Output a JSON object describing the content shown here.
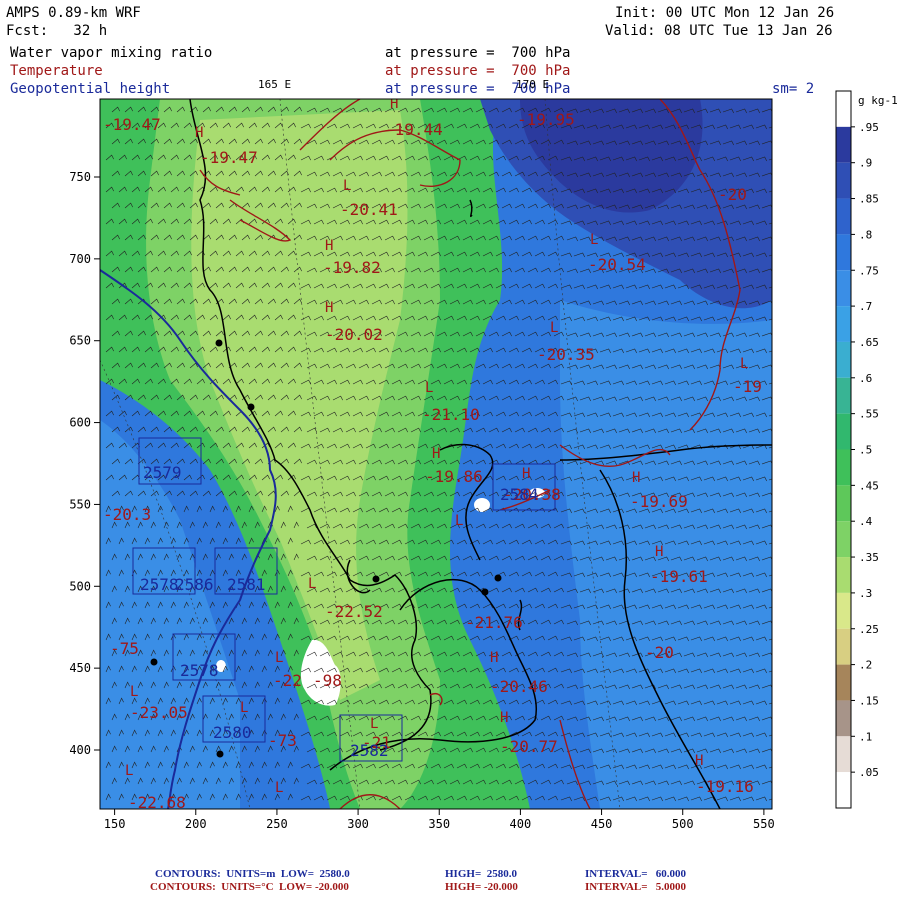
{
  "header": {
    "model": "AMPS 0.89-km WRF",
    "forecast": "Fcst:   32 h",
    "init": "Init: 00 UTC Mon 12 Jan 26",
    "valid": "Valid: 08 UTC Tue 13 Jan 26",
    "field1": "Water vapor mixing ratio",
    "field2": "Temperature",
    "field3": "Geopotential height",
    "level1": "at pressure =  700 hPa",
    "level2": "at pressure =  700 hPa",
    "level3": "at pressure =  700 hPa",
    "sm": "sm= 2",
    "lon1": "165 E",
    "lon2": "170 E"
  },
  "axes": {
    "x_ticks": [
      "150",
      "200",
      "250",
      "300",
      "350",
      "400",
      "450",
      "500",
      "550"
    ],
    "y_ticks": [
      "750",
      "700",
      "650",
      "600",
      "550",
      "500",
      "450",
      "400"
    ]
  },
  "colorbar": {
    "unit": "g kg-1",
    "levels": [
      ".95",
      ".9",
      ".85",
      ".8",
      ".75",
      ".7",
      ".65",
      ".6",
      ".55",
      ".5",
      ".45",
      ".4",
      ".35",
      ".3",
      ".25",
      ".2",
      ".15",
      ".1",
      ".05"
    ],
    "colors": [
      "#2b3a9e",
      "#2f4fb5",
      "#2f63cc",
      "#2f78dd",
      "#3a8ee6",
      "#3aa1e6",
      "#3aaed0",
      "#38b494",
      "#31b86e",
      "#3fc05a",
      "#5ec85a",
      "#7ed266",
      "#a9dc70",
      "#d9e88a",
      "#d8cf82",
      "#a6855b",
      "#a79489",
      "#e6dcd6",
      "#ffffff"
    ]
  },
  "labels": {
    "temps": [
      "-19.47",
      "-19.47",
      "-19.44",
      "-19.95",
      "-20",
      "-20.41",
      "-19.82",
      "-20.54",
      "-20.02",
      "-20.35",
      "-19",
      "-21.10",
      "-19.86",
      "-19.69",
      "-20.38",
      "-19.61",
      "-20.3",
      "-22.52",
      "-21.76",
      "-20",
      "-75",
      "-22",
      "-98",
      "-20.46",
      "-23.05",
      "-73",
      "-20.77",
      "-19.16",
      "-22.68",
      "-21"
    ],
    "heights": [
      "2579",
      "2578",
      "2586",
      "2581",
      "2578",
      "2580",
      "2582",
      "2584"
    ],
    "hl_marks": [
      "H",
      "H",
      "L",
      "H",
      "H",
      "L",
      "L",
      "L",
      "H",
      "H",
      "L",
      "H",
      "H",
      "L",
      "H",
      "L",
      "L",
      "L",
      "L",
      "H",
      "L",
      "H",
      "L",
      "L"
    ]
  },
  "footer": {
    "line1_label": "CONTOURS:  UNITS=m  LOW=  2580.0",
    "line1_high": "HIGH=  2580.0",
    "line1_int": "INTERVAL=   60.000",
    "line2_label": "CONTOURS:  UNITS=°C  LOW= -20.000",
    "line2_high": "HIGH= -20.000",
    "line2_int": "INTERVAL=   5.0000"
  },
  "colors": {
    "temp": "#a01818",
    "height": "#1a2a9a"
  }
}
